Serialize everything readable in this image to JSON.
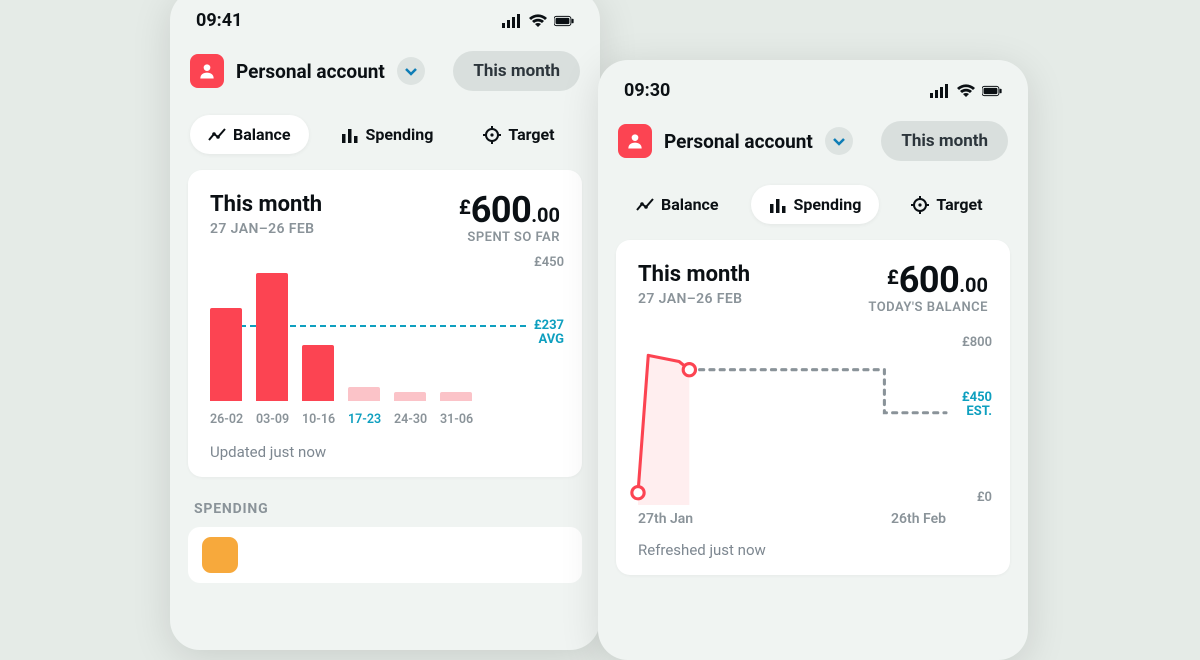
{
  "colors": {
    "brand_red": "#fc4452",
    "teal": "#0e9fbf",
    "grey_text": "#8a9399"
  },
  "phone1": {
    "status": {
      "time": "09:41"
    },
    "account": {
      "name": "Personal account"
    },
    "period_label": "This month",
    "tabs": {
      "balance": "Balance",
      "spending": "Spending",
      "target": "Target",
      "active": "balance"
    },
    "card": {
      "title": "This month",
      "date_range": "27 JAN–26 FEB",
      "amount_currency": "£",
      "amount_major": "600",
      "amount_minor": ".00",
      "amount_sub": "SPENT SO FAR",
      "tick_top": "£450",
      "avg_label_top": "£237",
      "avg_label_bottom": "AVG",
      "updated": "Updated just now"
    },
    "section_spending": "SPENDING",
    "chart_data": {
      "type": "bar",
      "title": "This month — Spent so far",
      "ylabel": "£",
      "ylim": [
        0,
        450
      ],
      "avg_value": 237,
      "categories": [
        "26-02",
        "03-09",
        "10-16",
        "17-23",
        "24-30",
        "31-06"
      ],
      "values": [
        300,
        410,
        180,
        45,
        30,
        30
      ],
      "active_index": 3,
      "faded_from_index": 3
    }
  },
  "phone2": {
    "status": {
      "time": "09:30"
    },
    "account": {
      "name": "Personal account"
    },
    "period_label": "This month",
    "tabs": {
      "balance": "Balance",
      "spending": "Spending",
      "target": "Target",
      "active": "spending"
    },
    "card": {
      "title": "This month",
      "date_range": "27 JAN–26 FEB",
      "amount_currency": "£",
      "amount_major": "600",
      "amount_minor": ".00",
      "amount_sub": "TODAY'S BALANCE",
      "tick_top": "£800",
      "tick_bottom": "£0",
      "est_label_top": "£450",
      "est_label_bottom": "EST.",
      "x_start": "27th Jan",
      "x_end": "26th Feb",
      "updated": "Refreshed just now"
    },
    "chart_data": {
      "type": "line",
      "title": "This month — Today's balance",
      "ylabel": "£",
      "ylim": [
        0,
        800
      ],
      "x_range": [
        "27th Jan",
        "26th Feb"
      ],
      "series": [
        {
          "name": "Balance",
          "points": [
            {
              "x": 0,
              "y": 60
            },
            {
              "x": 1,
              "y": 730
            },
            {
              "x": 4,
              "y": 700
            },
            {
              "x": 5,
              "y": 660
            }
          ]
        }
      ],
      "projection": {
        "from": {
          "x": 5,
          "y": 660
        },
        "flat_to_x": 24,
        "drop_to_y": 450,
        "end_x": 30,
        "end_y": 450
      },
      "est_value": 450
    }
  }
}
